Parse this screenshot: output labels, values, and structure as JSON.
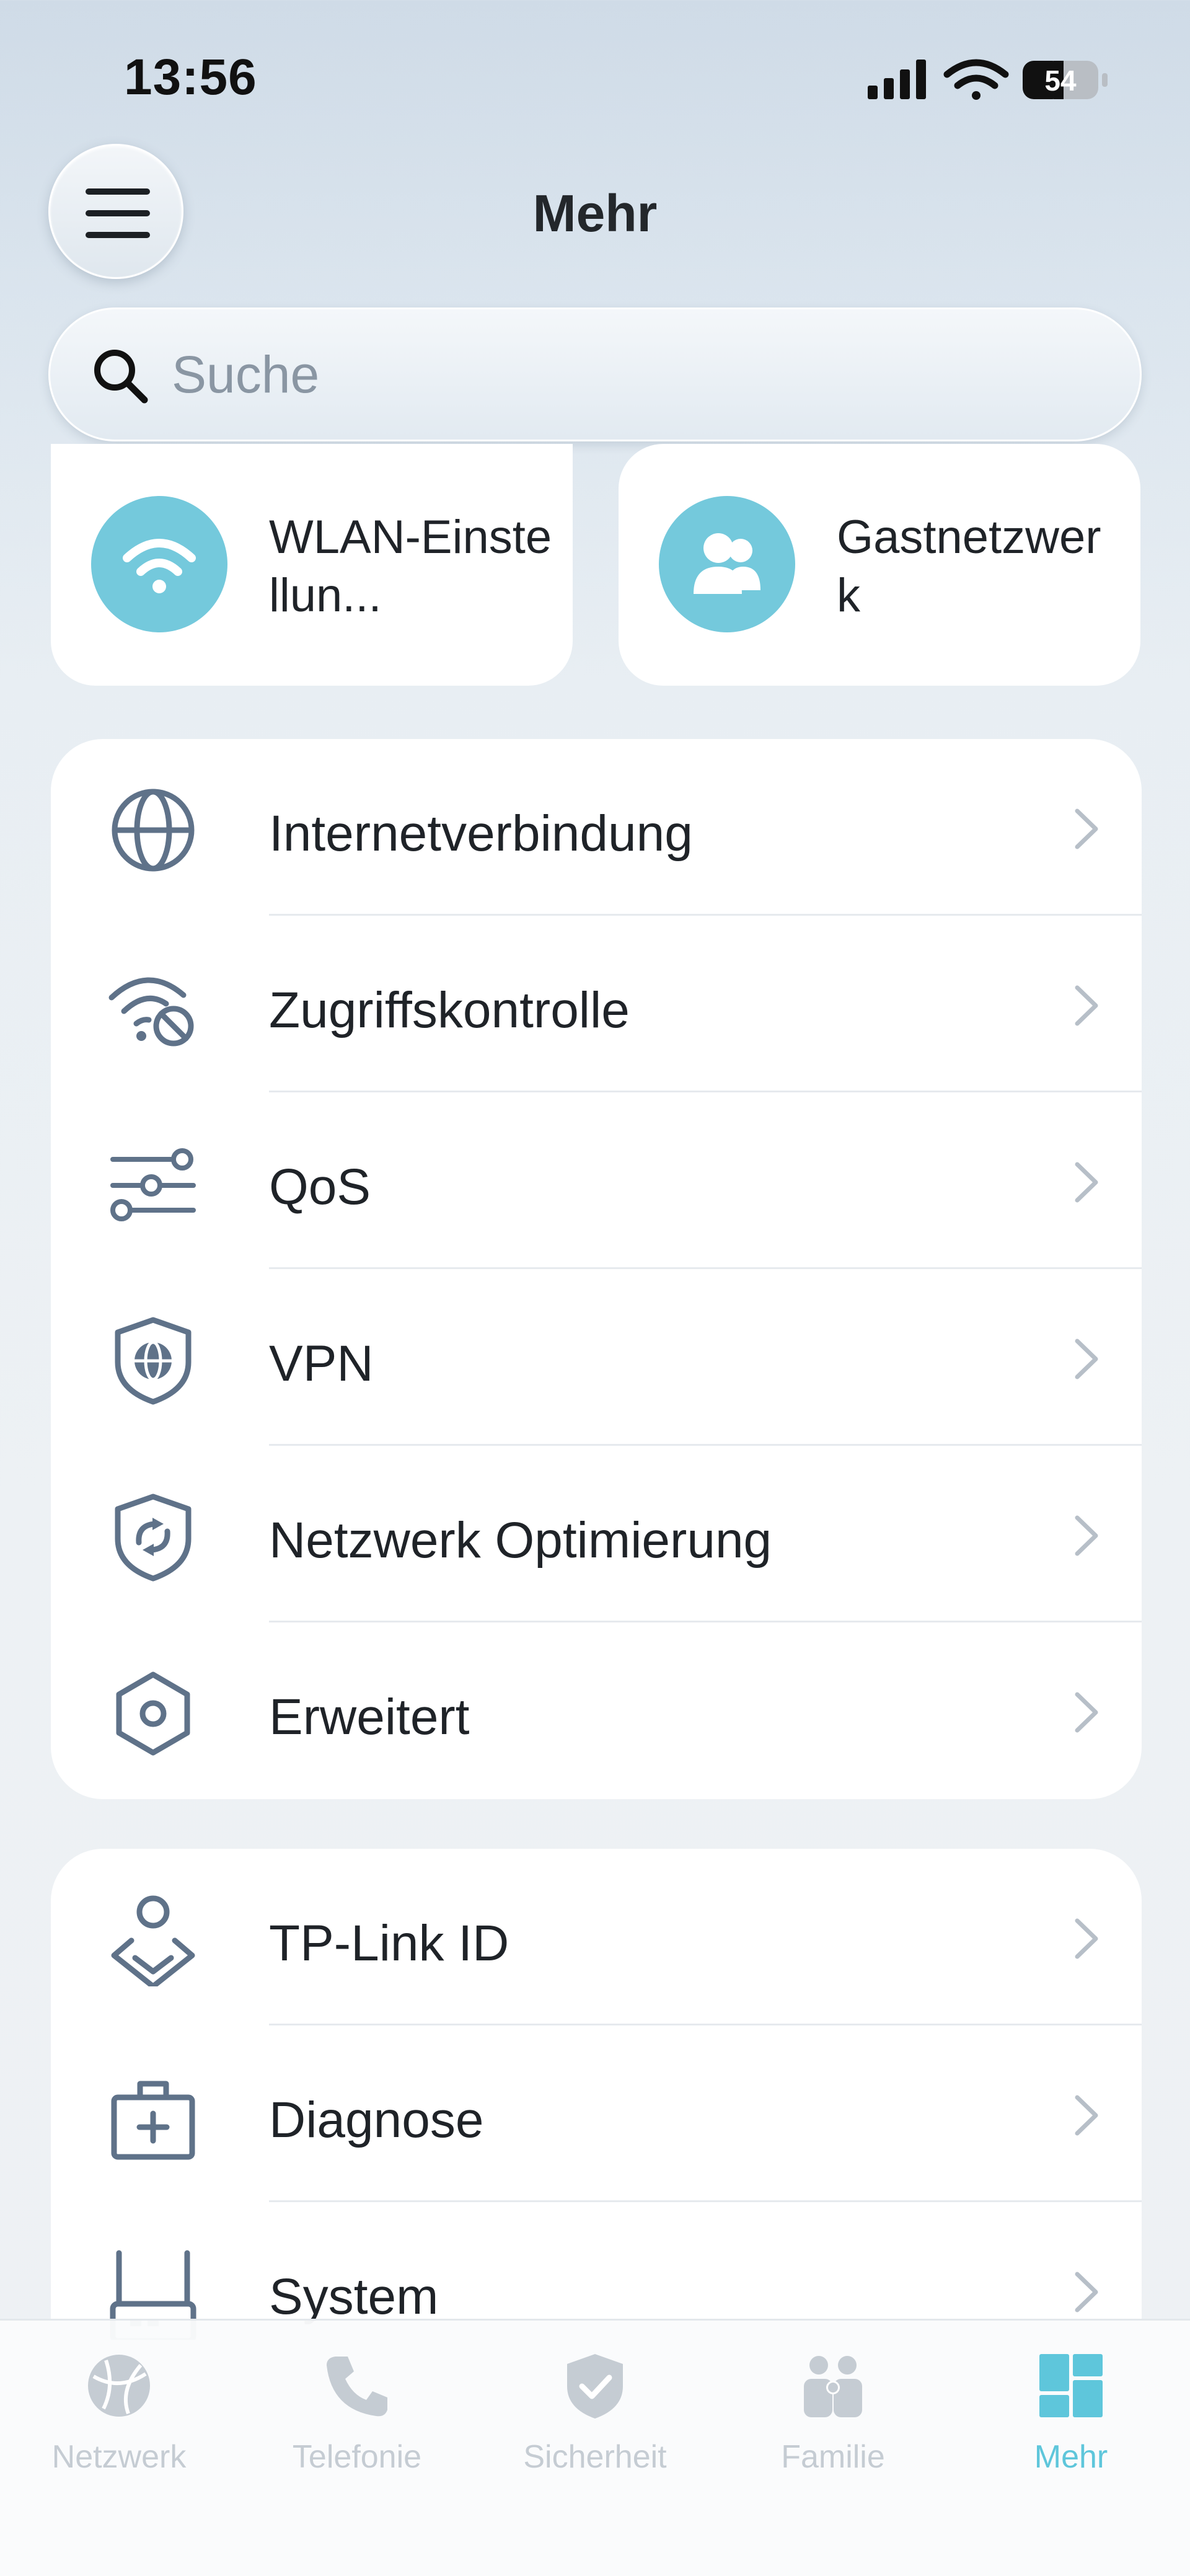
{
  "status_bar": {
    "time": "13:56",
    "battery": "54"
  },
  "header": {
    "title": "Mehr"
  },
  "search": {
    "placeholder": "Suche"
  },
  "quick_cards": [
    {
      "label": "WLAN-Einstellun...",
      "icon": "wifi-icon"
    },
    {
      "label": "Gastnetzwerk",
      "icon": "guests-icon"
    }
  ],
  "section_1": [
    {
      "label": "Internetverbindung",
      "icon": "globe-icon"
    },
    {
      "label": "Zugriffskontrolle",
      "icon": "wifi-block-icon"
    },
    {
      "label": "QoS",
      "icon": "sliders-icon"
    },
    {
      "label": "VPN",
      "icon": "shield-globe-icon"
    },
    {
      "label": "Netzwerk Optimierung",
      "icon": "shield-refresh-icon"
    },
    {
      "label": "Erweitert",
      "icon": "hexagon-gear-icon"
    }
  ],
  "section_2": [
    {
      "label": "TP-Link ID",
      "icon": "person-diamond-icon"
    },
    {
      "label": "Diagnose",
      "icon": "first-aid-kit-icon"
    },
    {
      "label": "System",
      "icon": "router-icon"
    }
  ],
  "tabs": [
    {
      "label": "Netzwerk",
      "icon": "globe-tab-icon",
      "active": false
    },
    {
      "label": "Telefonie",
      "icon": "phone-icon",
      "active": false
    },
    {
      "label": "Sicherheit",
      "icon": "shield-check-icon",
      "active": false
    },
    {
      "label": "Familie",
      "icon": "family-icon",
      "active": false
    },
    {
      "label": "Mehr",
      "icon": "grid-icon",
      "active": true
    }
  ],
  "colors": {
    "accent": "#5ec6db",
    "icon_circle": "#74c9dc",
    "icon_stroke": "#5f7289",
    "inactive_tab": "#c5ccd3"
  }
}
